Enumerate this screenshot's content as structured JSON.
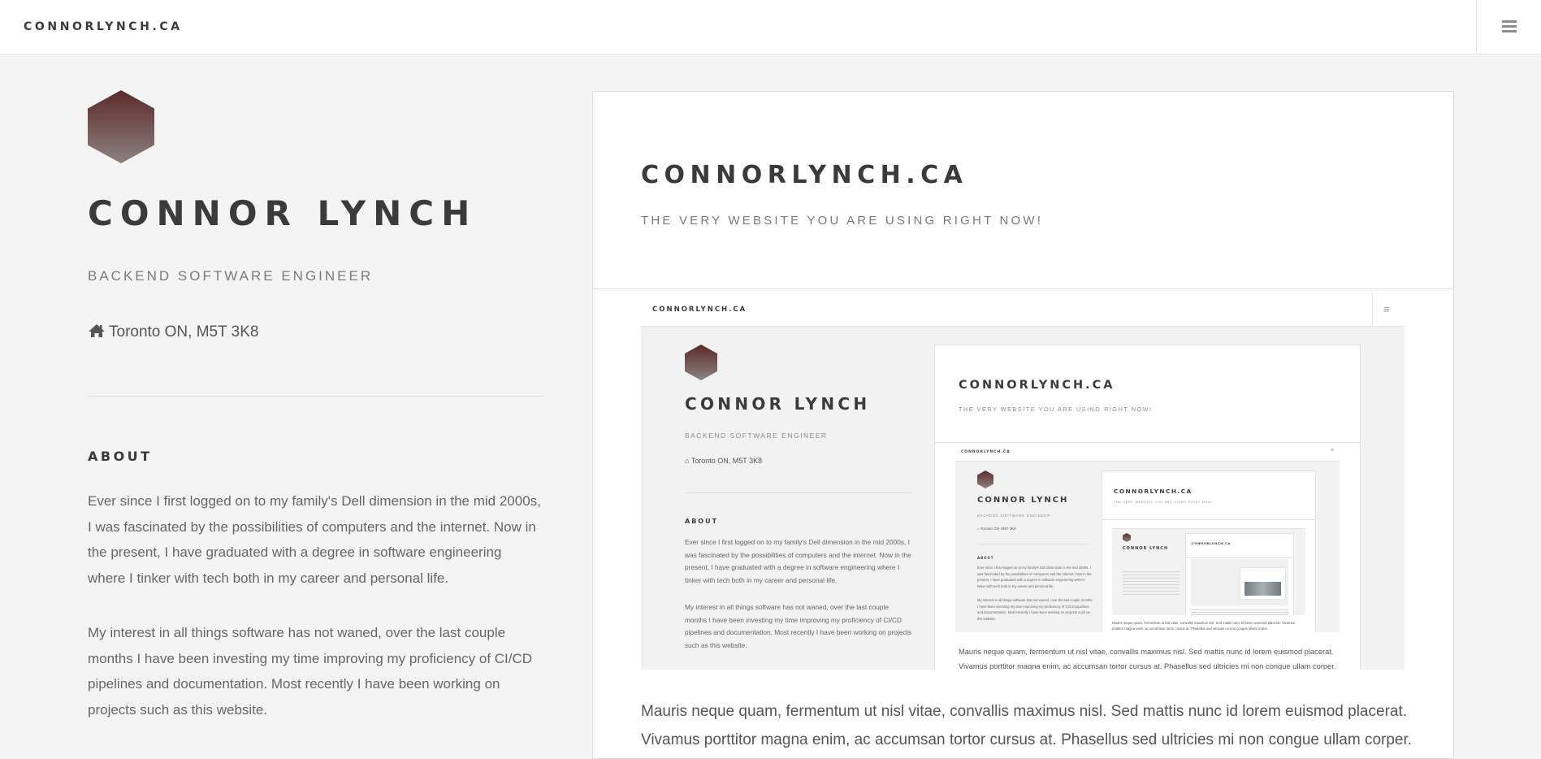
{
  "header": {
    "brand": "CONNORLYNCH.CA",
    "menu_icon": "hamburger-menu-icon"
  },
  "profile": {
    "avatar_icon": "hexagon-avatar-icon",
    "name": "CONNOR LYNCH",
    "role": "BACKEND SOFTWARE ENGINEER",
    "location_icon": "home-icon",
    "location": "Toronto ON, M5T 3K8"
  },
  "about": {
    "heading": "ABOUT",
    "paragraphs": [
      "Ever since I first logged on to my family's Dell dimension in the mid 2000s, I was fascinated by the possibilities of computers and the internet. Now in the present, I have graduated with a degree in software engineering where I tinker with tech both in my career and personal life.",
      "My interest in all things software has not waned, over the last couple months I have been investing my time improving my proficiency of CI/CD pipelines and documentation. Most recently I have been working on projects such as this website."
    ]
  },
  "project": {
    "title": "CONNORLYNCH.CA",
    "subtitle": "THE VERY WEBSITE YOU ARE USING RIGHT NOW!",
    "description": "Mauris neque quam, fermentum ut nisl vitae, convallis maximus nisl. Sed mattis nunc id lorem euismod placerat. Vivamus porttitor magna enim, ac accumsan tortor cursus at. Phasellus sed ultricies mi non congue ullam corper."
  },
  "colors": {
    "text_dark": "#3c3b3b",
    "hex_top": "#5c2a2a",
    "hex_bottom": "#8a7f7d",
    "background": "#f4f4f4",
    "card": "#ffffff"
  }
}
